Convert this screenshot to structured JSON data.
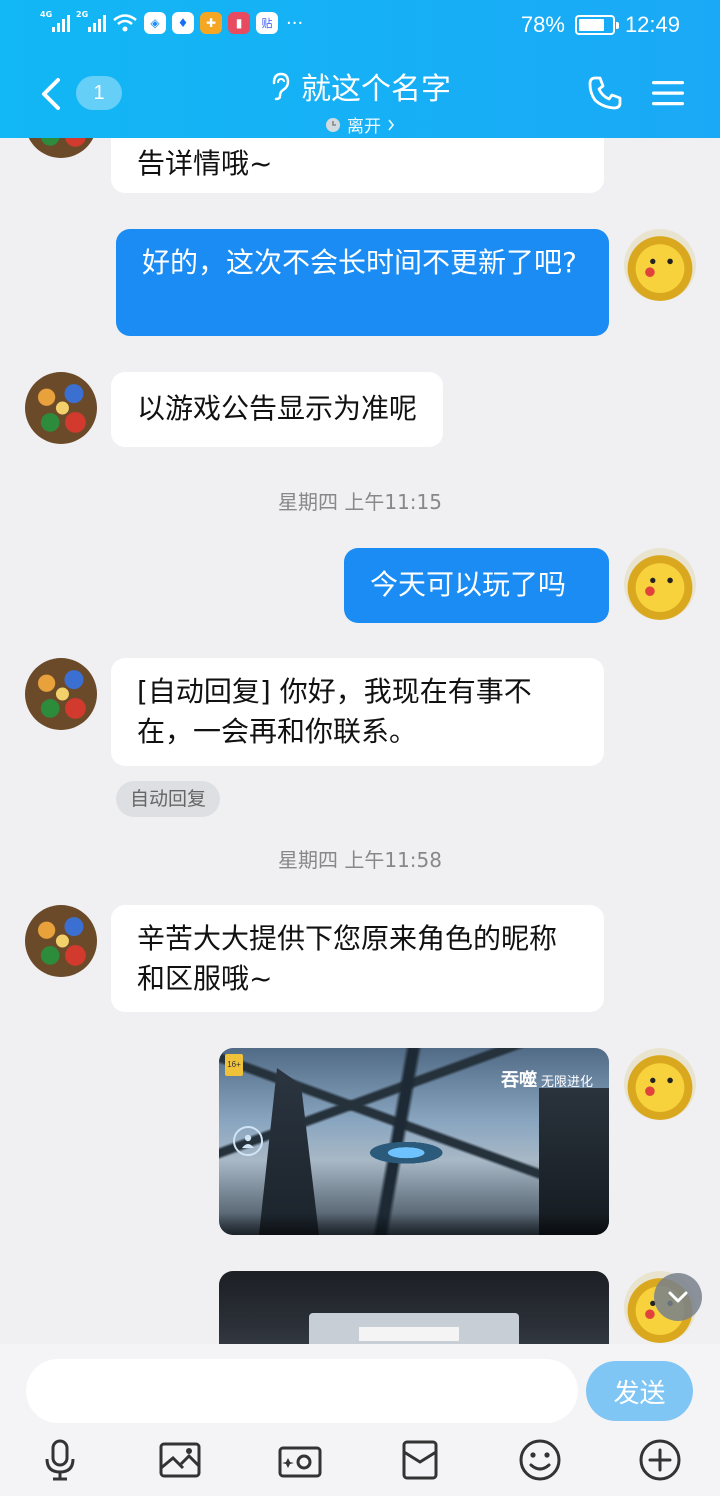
{
  "status_bar": {
    "signal1": "4G",
    "signal2": "2G",
    "battery": "78%",
    "battery_level": 0.78,
    "time": "12:49"
  },
  "header": {
    "unread_count": "1",
    "contact_name": "就这个名字",
    "status_text": "离开",
    "bg_color": "#12b7f5"
  },
  "messages": {
    "m1_text": "告详情哦~",
    "m2_text": "好的，这次不会长时间不更新了吧?",
    "m3_text": "以游戏公告显示为准呢",
    "ts1": "星期四 上午11:15",
    "m4_text": "今天可以玩了吗",
    "m5_text": "[自动回复] 你好，我现在有事不在，一会再和你联系。",
    "auto_reply_tag": "自动回复",
    "ts2": "星期四 上午11:58",
    "m6_text": "辛苦大大提供下您原来角色的昵称和区服哦~"
  },
  "input": {
    "value": "",
    "send_label": "发送"
  },
  "toolbar_icons": [
    "microphone-icon",
    "image-icon",
    "camera-icon",
    "red-packet-icon",
    "emoji-icon",
    "plus-icon"
  ],
  "colors": {
    "accent": "#12b7f5",
    "outgoing_bubble": "#1a8cf4",
    "send_button": "#7fc6f5"
  }
}
